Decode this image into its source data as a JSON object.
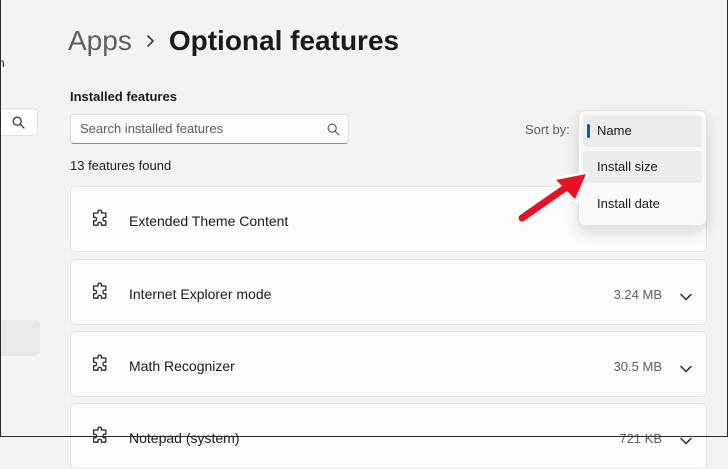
{
  "sidebar": {
    "cut_text": "n",
    "search_icon": "search-icon"
  },
  "breadcrumb": {
    "parent": "Apps",
    "separator_icon": "chevron-right-icon",
    "current": "Optional features"
  },
  "installed": {
    "section_label": "Installed features",
    "search_placeholder": "Search installed features",
    "search_value": "",
    "sort_label": "Sort by:",
    "count_text": "13 features found",
    "features": [
      {
        "name": "Extended Theme Content",
        "size": "",
        "icon": "puzzle-icon"
      },
      {
        "name": "Internet Explorer mode",
        "size": "3.24 MB",
        "icon": "puzzle-icon"
      },
      {
        "name": "Math Recognizer",
        "size": "30.5 MB",
        "icon": "puzzle-icon"
      },
      {
        "name": "Notepad (system)",
        "size": "721 KB",
        "icon": "puzzle-icon"
      }
    ]
  },
  "sort_menu": {
    "options": [
      {
        "label": "Name",
        "selected": true
      },
      {
        "label": "Install size",
        "selected": false
      },
      {
        "label": "Install date",
        "selected": false
      }
    ]
  },
  "annotation": {
    "arrow_color": "#e81123"
  },
  "colors": {
    "accent": "#005fb8",
    "background": "#f3f3f3",
    "card": "#fbfbfb"
  }
}
